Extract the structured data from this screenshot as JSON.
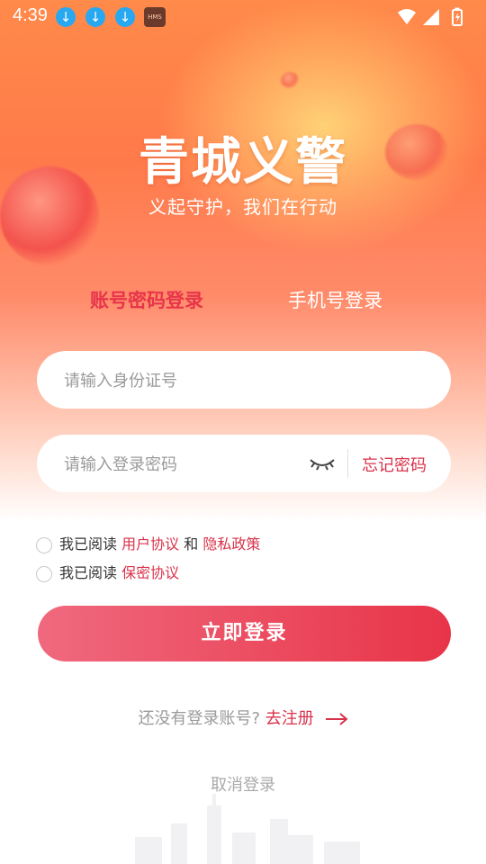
{
  "status_bar": {
    "time": "4:39",
    "hms_label": "HMS",
    "icons": [
      "download-icon",
      "download-icon",
      "download-icon",
      "hms-icon",
      "wifi-icon",
      "signal-icon",
      "battery-icon"
    ]
  },
  "header": {
    "logo_text": "青城义警",
    "slogan": "义起守护，我们在行动"
  },
  "tabs": [
    {
      "label": "账号密码登录",
      "active": true
    },
    {
      "label": "手机号登录",
      "active": false
    }
  ],
  "form": {
    "id_placeholder": "请输入身份证号",
    "password_placeholder": "请输入登录密码",
    "forgot_label": "忘记密码"
  },
  "agreements": {
    "read_prefix": "我已阅读",
    "user_agreement": "用户协议",
    "and": "和",
    "privacy_policy": "隐私政策",
    "confidentiality": "保密协议"
  },
  "actions": {
    "login_label": "立即登录",
    "no_account": "还没有登录账号?",
    "register_label": "去注册",
    "cancel_label": "取消登录"
  },
  "colors": {
    "accent": "#e8344a",
    "link": "#d8324a"
  }
}
